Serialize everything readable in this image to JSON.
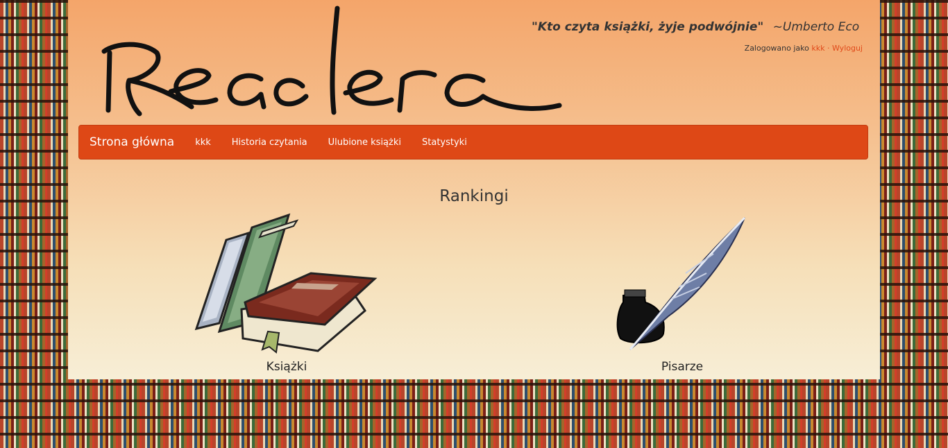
{
  "header": {
    "logo_text": "Readera",
    "quote": "\"Kto czyta książki, żyje podwójnie\"",
    "quote_author": "~Umberto Eco",
    "login_prefix": "Zalogowano jako",
    "username": "kkk",
    "separator": "·",
    "logout": "Wyloguj"
  },
  "nav": {
    "brand": "Strona główna",
    "items": [
      "kkk",
      "Historia czytania",
      "Ulubione książki",
      "Statystyki"
    ]
  },
  "main": {
    "title": "Rankingi",
    "tiles": [
      {
        "label": "Książki",
        "icon": "books-icon"
      },
      {
        "label": "Pisarze",
        "icon": "quill-inkwell-icon"
      }
    ]
  },
  "colors": {
    "navbar": "#de4816",
    "link": "#e0491a",
    "header_gradient_top": "#f4a56a",
    "header_gradient_bottom": "#f7eed6"
  }
}
